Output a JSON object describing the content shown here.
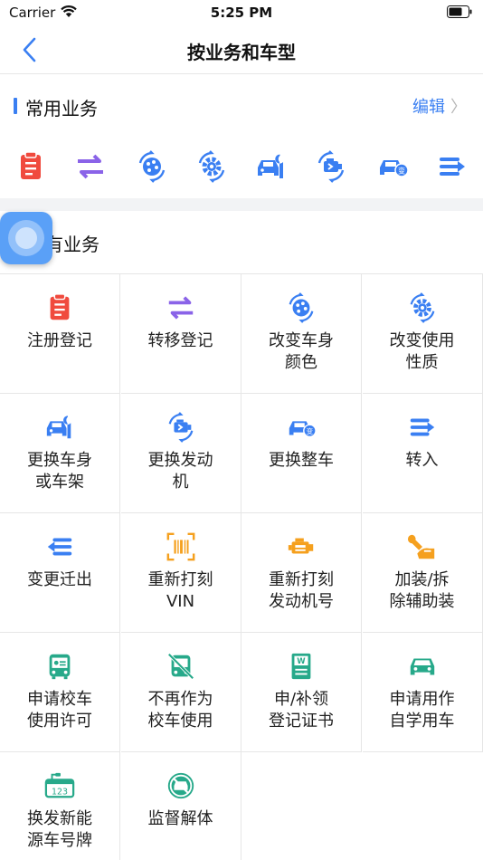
{
  "status_bar": {
    "carrier": "Carrier",
    "time": "5:25 PM"
  },
  "nav": {
    "title": "按业务和车型"
  },
  "common_section": {
    "title": "常用业务",
    "edit_label": "编辑"
  },
  "all_section": {
    "title": "有业务"
  },
  "colors": {
    "accent": "#3a7ff2",
    "red": "#f04a3e",
    "purple": "#8a63e8",
    "blue": "#3a7ff2",
    "orange": "#f5a01e",
    "teal": "#27a98a"
  },
  "quick_icons": [
    "clipboard-icon",
    "transfer-arrows-icon",
    "palette-refresh-icon",
    "gear-refresh-icon",
    "car-wrench-icon",
    "engine-refresh-icon",
    "car-change-icon",
    "list-arrow-icon"
  ],
  "services": [
    {
      "label": "注册登记",
      "icon": "clipboard-icon"
    },
    {
      "label": "转移登记",
      "icon": "transfer-arrows-icon"
    },
    {
      "label": "改变车身\n颜色",
      "icon": "palette-refresh-icon"
    },
    {
      "label": "改变使用\n性质",
      "icon": "gear-refresh-icon"
    },
    {
      "label": "更换车身\n或车架",
      "icon": "car-wrench-icon"
    },
    {
      "label": "更换发动\n机",
      "icon": "engine-refresh-icon"
    },
    {
      "label": "更换整车",
      "icon": "car-change-icon"
    },
    {
      "label": "转入",
      "icon": "list-arrow-in-icon"
    },
    {
      "label": "变更迁出",
      "icon": "list-arrow-out-icon"
    },
    {
      "label": "重新打刻\nVIN",
      "icon": "barcode-scan-icon"
    },
    {
      "label": "重新打刻\n发动机号",
      "icon": "engine-icon"
    },
    {
      "label": "加装/拆\n除辅助装",
      "icon": "wrench-hand-icon"
    },
    {
      "label": "申请校车\n使用许可",
      "icon": "school-bus-icon"
    },
    {
      "label": "不再作为\n校车使用",
      "icon": "bus-cancel-icon"
    },
    {
      "label": "申/补领\n登记证书",
      "icon": "certificate-icon"
    },
    {
      "label": "申请用作\n自学用车",
      "icon": "car-front-icon"
    },
    {
      "label": "换发新能\n源车号牌",
      "icon": "plate-123-icon"
    },
    {
      "label": "监督解体",
      "icon": "car-forbidden-icon"
    }
  ]
}
